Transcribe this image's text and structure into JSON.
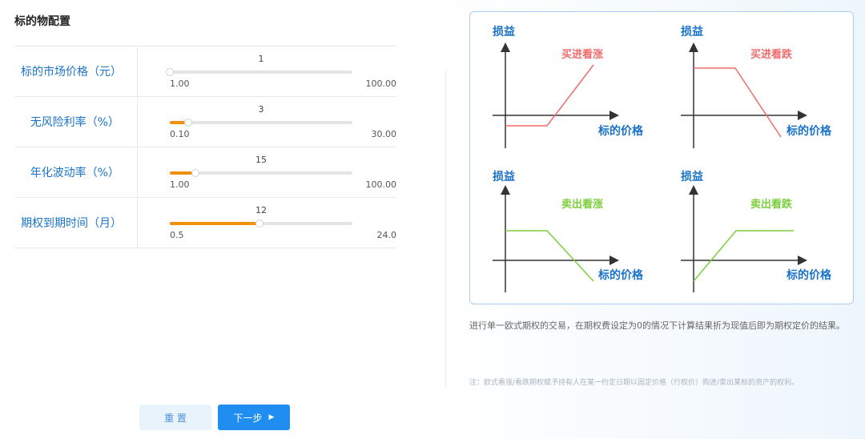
{
  "title": "标的物配置",
  "params": [
    {
      "label": "标的市场价格（元）",
      "value": "1",
      "min_label": "1.00",
      "max_label": "100.00",
      "fraction": 0.0
    },
    {
      "label": "无风险利率（%）",
      "value": "3",
      "min_label": "0.10",
      "max_label": "30.00",
      "fraction": 0.1
    },
    {
      "label": "年化波动率（%）",
      "value": "15",
      "min_label": "1.00",
      "max_label": "100.00",
      "fraction": 0.14
    },
    {
      "label": "期权到期时间（月）",
      "value": "12",
      "min_label": "0.5",
      "max_label": "24.0",
      "fraction": 0.49
    }
  ],
  "diagram": {
    "y_label": "损益",
    "x_label": "标的价格",
    "charts": [
      {
        "name": "买进看涨",
        "color": "#f06b6b"
      },
      {
        "name": "买进看跌",
        "color": "#f06b6b"
      },
      {
        "name": "卖出看涨",
        "color": "#7ccf3c"
      },
      {
        "name": "卖出看跌",
        "color": "#7ccf3c"
      }
    ]
  },
  "description": "进行单一欧式期权的交易，在期权费设定为0的情况下计算结果折为现值后即为期权定价的结果。",
  "note": "注：欧式看涨/看跌期权赋予持有人在某一约定日期以固定价格（行权价）购进/卖出某标的资产的权利。",
  "buttons": {
    "reset": "重 置",
    "next": "下一步"
  },
  "colors": {
    "accent": "#1f8ef0",
    "slider_fill": "#f0900c",
    "label_blue": "#1a73c9"
  }
}
